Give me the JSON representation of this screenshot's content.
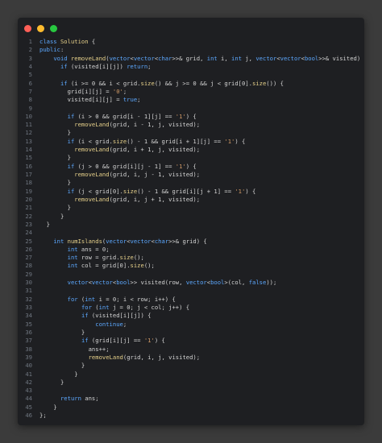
{
  "window": {
    "controls": [
      "close",
      "minimize",
      "maximize"
    ],
    "colors": {
      "close": "#ff5f57",
      "minimize": "#febc2e",
      "maximize": "#28c840",
      "background": "#1e1f22"
    }
  },
  "editor": {
    "lines": [
      {
        "n": "1",
        "text": "class Solution {"
      },
      {
        "n": "2",
        "text": "public:"
      },
      {
        "n": "3",
        "text": "    void removeLand(vector<vector<char>>& grid, int i, int j, vector<vector<bool>>& visited) {"
      },
      {
        "n": "4",
        "text": "      if (visited[i][j]) return;"
      },
      {
        "n": "5",
        "text": ""
      },
      {
        "n": "6",
        "text": "      if (i >= 0 && i < grid.size() && j >= 0 && j < grid[0].size()) {"
      },
      {
        "n": "7",
        "text": "        grid[i][j] = '0';"
      },
      {
        "n": "8",
        "text": "        visited[i][j] = true;"
      },
      {
        "n": "9",
        "text": ""
      },
      {
        "n": "10",
        "text": "        if (i > 0 && grid[i - 1][j] == '1') {"
      },
      {
        "n": "11",
        "text": "          removeLand(grid, i - 1, j, visited);"
      },
      {
        "n": "12",
        "text": "        }"
      },
      {
        "n": "13",
        "text": "        if (i < grid.size() - 1 && grid[i + 1][j] == '1') {"
      },
      {
        "n": "14",
        "text": "          removeLand(grid, i + 1, j, visited);"
      },
      {
        "n": "15",
        "text": "        }"
      },
      {
        "n": "16",
        "text": "        if (j > 0 && grid[i][j - 1] == '1') {"
      },
      {
        "n": "17",
        "text": "          removeLand(grid, i, j - 1, visited);"
      },
      {
        "n": "18",
        "text": "        }"
      },
      {
        "n": "19",
        "text": "        if (j < grid[0].size() - 1 && grid[i][j + 1] == '1') {"
      },
      {
        "n": "20",
        "text": "          removeLand(grid, i, j + 1, visited);"
      },
      {
        "n": "21",
        "text": "        }"
      },
      {
        "n": "22",
        "text": "      }"
      },
      {
        "n": "23",
        "text": "  }"
      },
      {
        "n": "24",
        "text": ""
      },
      {
        "n": "25",
        "text": "    int numIslands(vector<vector<char>>& grid) {"
      },
      {
        "n": "26",
        "text": "        int ans = 0;"
      },
      {
        "n": "27",
        "text": "        int row = grid.size();"
      },
      {
        "n": "28",
        "text": "        int col = grid[0].size();"
      },
      {
        "n": "29",
        "text": ""
      },
      {
        "n": "30",
        "text": "        vector<vector<bool>> visited(row, vector<bool>(col, false));"
      },
      {
        "n": "31",
        "text": ""
      },
      {
        "n": "32",
        "text": "        for (int i = 0; i < row; i++) {"
      },
      {
        "n": "33",
        "text": "            for (int j = 0; j < col; j++) {"
      },
      {
        "n": "34",
        "text": "            if (visited[i][j]) {"
      },
      {
        "n": "35",
        "text": "                continue;"
      },
      {
        "n": "36",
        "text": "            }"
      },
      {
        "n": "37",
        "text": "            if (grid[i][j] == '1') {"
      },
      {
        "n": "38",
        "text": "              ans++;"
      },
      {
        "n": "39",
        "text": "              removeLand(grid, i, j, visited);"
      },
      {
        "n": "40",
        "text": "            }"
      },
      {
        "n": "41",
        "text": "          }"
      },
      {
        "n": "42",
        "text": "      }"
      },
      {
        "n": "43",
        "text": ""
      },
      {
        "n": "44",
        "text": "      return ans;"
      },
      {
        "n": "45",
        "text": "    }"
      },
      {
        "n": "46",
        "text": "};"
      }
    ]
  }
}
